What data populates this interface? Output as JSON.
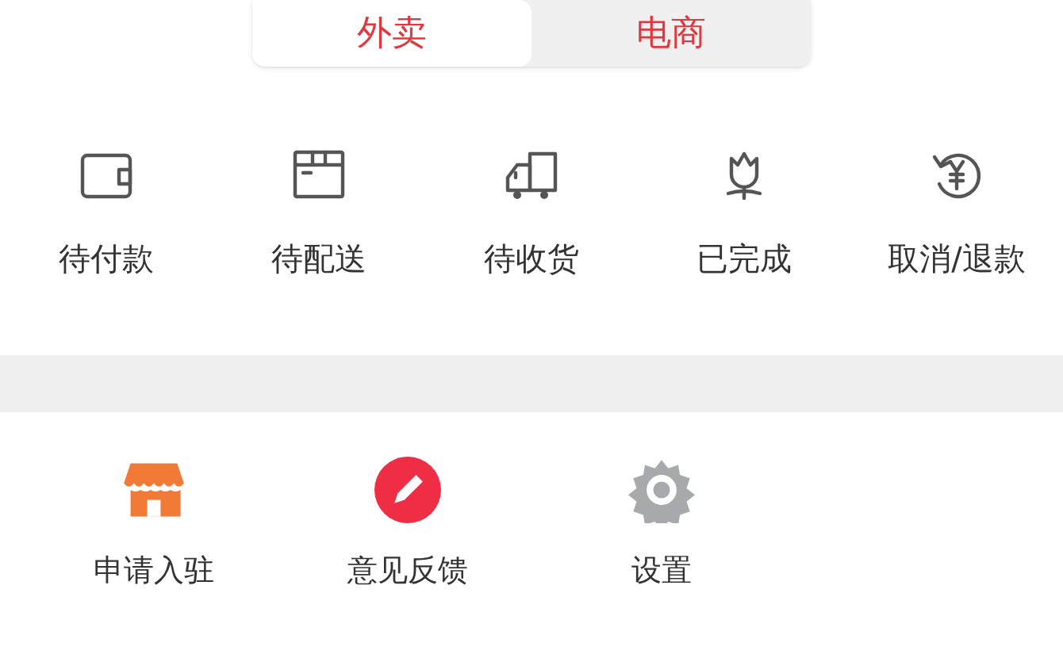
{
  "tabs": [
    {
      "label": "外卖",
      "selected": true
    },
    {
      "label": "电商",
      "selected": false
    }
  ],
  "order_status": [
    {
      "label": "待付款"
    },
    {
      "label": "待配送"
    },
    {
      "label": "待收货"
    },
    {
      "label": "已完成"
    },
    {
      "label": "取消/退款"
    }
  ],
  "services": [
    {
      "label": "申请入驻"
    },
    {
      "label": "意见反馈"
    },
    {
      "label": "设置"
    }
  ]
}
